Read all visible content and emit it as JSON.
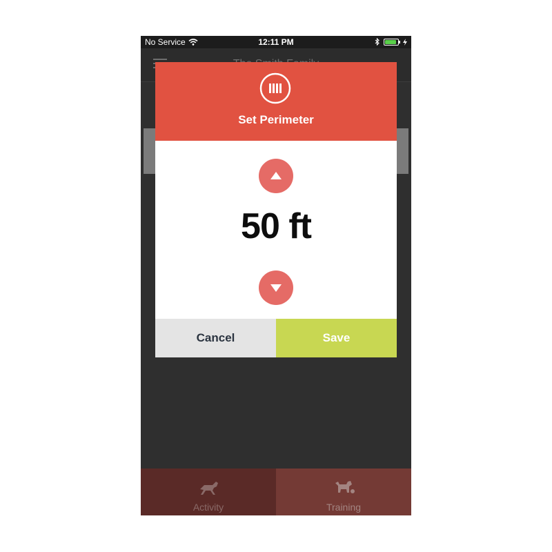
{
  "status_bar": {
    "carrier": "No Service",
    "time": "12:11 PM",
    "battery_level": 0.9
  },
  "header": {
    "title": "The Smith Family"
  },
  "modal": {
    "icon": "fence-icon",
    "title": "Set Perimeter",
    "value": "50 ft",
    "increase_icon": "triangle-up-icon",
    "decrease_icon": "triangle-down-icon",
    "cancel_label": "Cancel",
    "save_label": "Save"
  },
  "tabs": [
    {
      "label": "Activity",
      "icon": "running-dog-icon"
    },
    {
      "label": "Training",
      "icon": "dog-training-icon"
    }
  ],
  "colors": {
    "modal_header": "#e15241",
    "step_button": "#e56b66",
    "save_button": "#c8d752",
    "cancel_button": "#e4e4e4",
    "background": "#2f2f2f"
  }
}
